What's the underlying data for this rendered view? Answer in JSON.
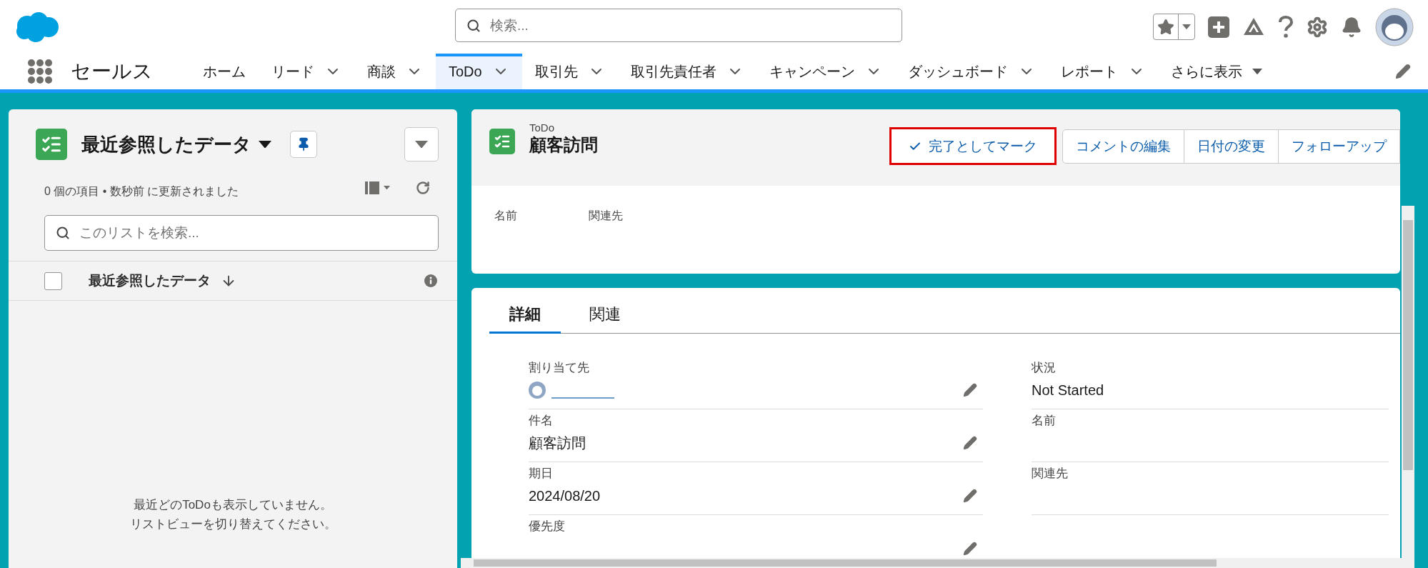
{
  "app": {
    "name": "セールス"
  },
  "search": {
    "placeholder": "検索..."
  },
  "nav_tabs": [
    {
      "label": "ホーム",
      "has_menu": false,
      "selected": false
    },
    {
      "label": "リード",
      "has_menu": true,
      "selected": false
    },
    {
      "label": "商談",
      "has_menu": true,
      "selected": false
    },
    {
      "label": "ToDo",
      "has_menu": true,
      "selected": true
    },
    {
      "label": "取引先",
      "has_menu": true,
      "selected": false
    },
    {
      "label": "取引先責任者",
      "has_menu": true,
      "selected": false
    },
    {
      "label": "キャンペーン",
      "has_menu": true,
      "selected": false
    },
    {
      "label": "ダッシュボード",
      "has_menu": true,
      "selected": false
    },
    {
      "label": "レポート",
      "has_menu": true,
      "selected": false
    }
  ],
  "more": {
    "label": "さらに表示"
  },
  "list_panel": {
    "title": "最近参照したデータ",
    "status": "0 個の項目 • 数秒前 に更新されました",
    "search_placeholder": "このリストを検索...",
    "column": "最近参照したデータ",
    "select_all_checked": false,
    "empty_lines": [
      "最近どのToDoも表示していません。",
      "リストビューを切り替えてください。"
    ]
  },
  "record": {
    "object": "ToDo",
    "title": "顧客訪問",
    "actions": [
      {
        "label": "完了としてマーク",
        "highlighted": true,
        "check": true
      },
      {
        "label": "コメントの編集",
        "highlighted": false,
        "check": false
      },
      {
        "label": "日付の変更",
        "highlighted": false,
        "check": false
      },
      {
        "label": "フォローアップ",
        "highlighted": false,
        "check": false
      }
    ],
    "highlights": [
      "名前",
      "関連先"
    ]
  },
  "detail_tabs": [
    {
      "label": "詳細",
      "selected": true
    },
    {
      "label": "関連",
      "selected": false
    }
  ],
  "fields_left": [
    {
      "label": "割り当て先",
      "kind": "user"
    },
    {
      "label": "件名",
      "kind": "text",
      "value": "顧客訪問"
    },
    {
      "label": "期日",
      "kind": "text",
      "value": "2024/08/20"
    },
    {
      "label": "優先度",
      "kind": "text"
    }
  ],
  "fields_right": [
    {
      "label": "状況",
      "value": "Not Started"
    },
    {
      "label": "名前"
    },
    {
      "label": "関連先"
    }
  ]
}
